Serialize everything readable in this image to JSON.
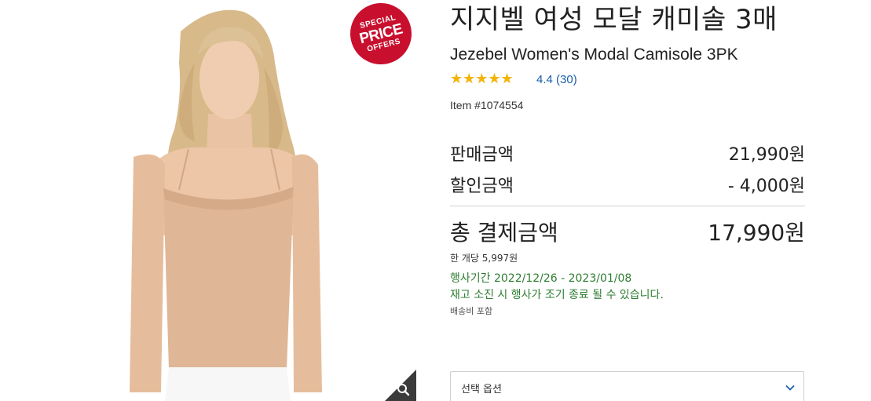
{
  "badge": {
    "line1": "SPECIAL",
    "line2": "PRICE",
    "line3": "OFFERS"
  },
  "product": {
    "title_ko": "지지벨 여성 모달 캐미솔 3매",
    "title_en": "Jezebel Women's Modal Camisole 3PK",
    "rating": {
      "value": 4.4,
      "max": 5,
      "text": "4.4 (30)"
    },
    "item_number": "Item #1074554"
  },
  "pricing": {
    "sale_label": "판매금액",
    "sale_value": "21,990원",
    "discount_label": "할인금액",
    "discount_value": "- 4,000원",
    "total_label": "총 결제금액",
    "total_value": "17,990원",
    "unit_price": "한 개당 5,997원"
  },
  "promo": {
    "period": "행사기간 2022/12/26 - 2023/01/08",
    "notice": "재고 소진 시 행사가 조기 종료 될 수 있습니다.",
    "shipping": "배송비 포함"
  },
  "option": {
    "placeholder": "선택 옵션"
  },
  "colors": {
    "badge": "#c8102e",
    "star": "#f4b400",
    "link": "#1a5ea8",
    "promo": "#2e7d32"
  },
  "icons": {
    "zoom": "magnifier-icon",
    "dropdown": "chevron-down-icon"
  }
}
